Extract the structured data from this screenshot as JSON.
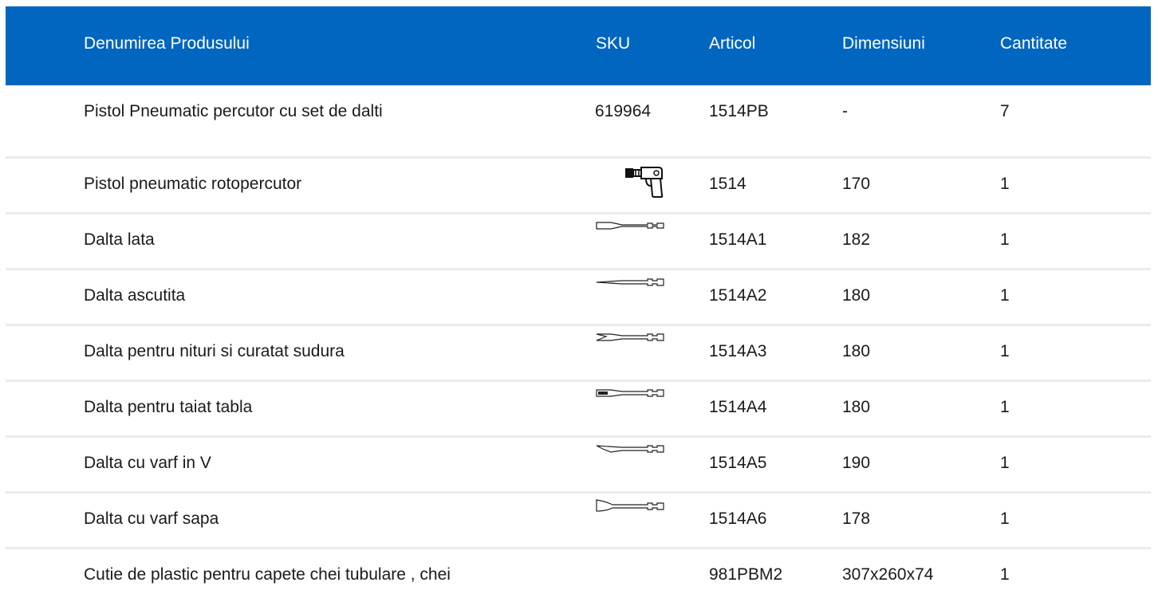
{
  "header": {
    "name": "Denumirea Produsului",
    "sku": "SKU",
    "article": "Articol",
    "dimensions": "Dimensiuni",
    "quantity": "Cantitate"
  },
  "rows": [
    {
      "name": "Pistol Pneumatic percutor cu set de dalti",
      "sku": "619964",
      "article": "1514PB",
      "dimensions": "-",
      "quantity": "7"
    },
    {
      "name": "Pistol pneumatic rotopercutor",
      "sku_icon": "air-hammer-gun-icon",
      "article": "1514",
      "dimensions": "170",
      "quantity": "1"
    },
    {
      "name": "Dalta lata",
      "sku_icon": "flat-chisel-icon",
      "article": "1514A1",
      "dimensions": "182",
      "quantity": "1"
    },
    {
      "name": "Dalta ascutita",
      "sku_icon": "pointed-chisel-icon",
      "article": "1514A2",
      "dimensions": "180",
      "quantity": "1"
    },
    {
      "name": "Dalta pentru nituri si curatat sudura",
      "sku_icon": "rivet-cutter-chisel-icon",
      "article": "1514A3",
      "dimensions": "180",
      "quantity": "1"
    },
    {
      "name": "Dalta pentru taiat tabla",
      "sku_icon": "panel-cutter-chisel-icon",
      "article": "1514A4",
      "dimensions": "180",
      "quantity": "1"
    },
    {
      "name": "Dalta cu varf in V",
      "sku_icon": "v-tip-chisel-icon",
      "article": "1514A5",
      "dimensions": "190",
      "quantity": "1"
    },
    {
      "name": "Dalta cu varf sapa",
      "sku_icon": "spade-tip-chisel-icon",
      "article": "1514A6",
      "dimensions": "178",
      "quantity": "1"
    },
    {
      "name": "Cutie de plastic pentru capete chei tubulare , chei",
      "sku": "",
      "article": "981PBM2",
      "dimensions": "307x260x74",
      "quantity": "1"
    }
  ],
  "colors": {
    "header_bg": "#0066bf",
    "header_text": "#ffffff",
    "row_divider": "#ebebeb"
  }
}
